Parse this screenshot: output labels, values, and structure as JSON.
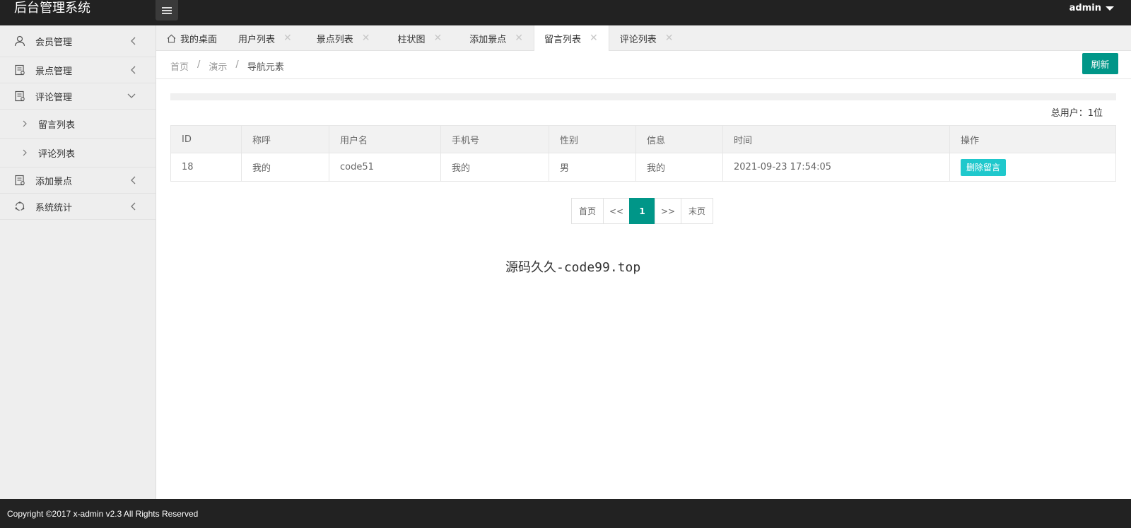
{
  "header": {
    "logo": "后台管理系统",
    "menu_toggle_icon": "hamburger-icon",
    "user": "admin"
  },
  "sidebar": {
    "items": [
      {
        "label": "会员管理",
        "icon": "user-icon",
        "expanded": false
      },
      {
        "label": "景点管理",
        "icon": "document-icon",
        "expanded": false
      },
      {
        "label": "评论管理",
        "icon": "document-icon",
        "expanded": true,
        "children": [
          {
            "label": "留言列表"
          },
          {
            "label": "评论列表"
          }
        ]
      },
      {
        "label": "添加景点",
        "icon": "document-icon",
        "expanded": false
      },
      {
        "label": "系统统计",
        "icon": "cycle-icon",
        "expanded": false
      }
    ]
  },
  "tabs": [
    {
      "label": "我的桌面",
      "closable": false,
      "active": false
    },
    {
      "label": "用户列表",
      "closable": true,
      "active": false
    },
    {
      "label": "景点列表",
      "closable": true,
      "active": false
    },
    {
      "label": "柱状图",
      "closable": true,
      "active": false
    },
    {
      "label": "添加景点",
      "closable": true,
      "active": false
    },
    {
      "label": "留言列表",
      "closable": true,
      "active": true
    },
    {
      "label": "评论列表",
      "closable": true,
      "active": false
    }
  ],
  "breadcrumb": {
    "items": [
      "首页",
      "演示",
      "导航元素"
    ],
    "separator": "/"
  },
  "refresh_label": "刷新",
  "total_users": "总用户：1位",
  "table": {
    "columns": [
      "ID",
      "称呼",
      "用户名",
      "手机号",
      "性别",
      "信息",
      "时间",
      "操作"
    ],
    "rows": [
      {
        "id": "18",
        "nickname": "我的",
        "username": "code51",
        "phone": "我的",
        "gender": "男",
        "info": "我的",
        "time": "2021-09-23 17:54:05",
        "action": "删除留言"
      }
    ]
  },
  "pager": {
    "first": "首页",
    "prev": "<<",
    "current": "1",
    "next": ">>",
    "last": "末页"
  },
  "watermark": "源码久久-code99.top",
  "footer": "Copyright ©2017 x-admin v2.3 All Rights Reserved",
  "colors": {
    "header_bg": "#222222",
    "accent": "#009688",
    "delete_button": "#1fc8cc"
  }
}
